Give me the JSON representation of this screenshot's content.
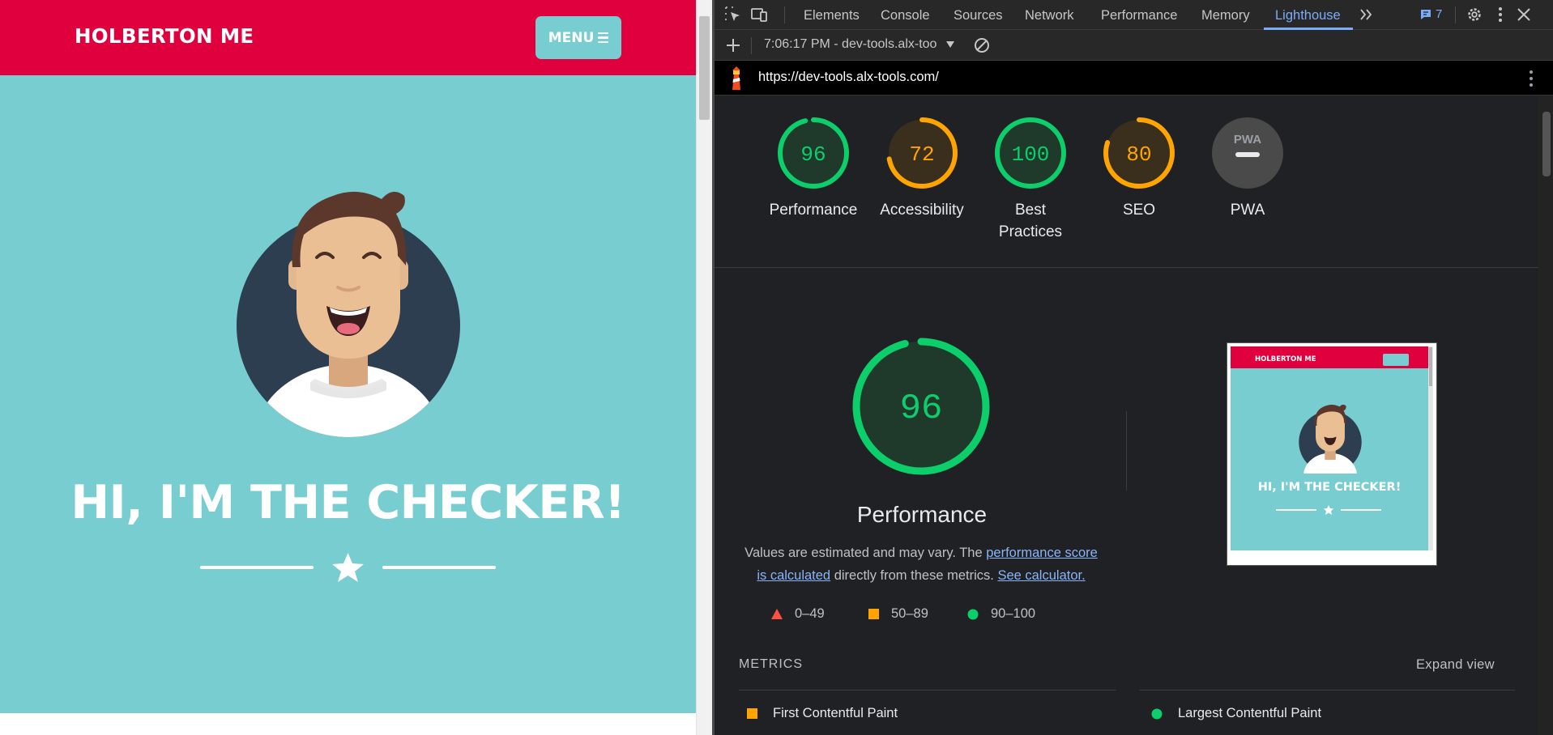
{
  "site": {
    "logo": "HOLBERTON ME",
    "menu_label": "MENU",
    "hero_title": "HI, I'M THE CHECKER!"
  },
  "devtools": {
    "tabs": [
      "Elements",
      "Console",
      "Sources",
      "Network",
      "Performance",
      "Memory",
      "Lighthouse"
    ],
    "active_tab": "Lighthouse",
    "issues_count": "7",
    "run_label": "7:06:17 PM - dev-tools.alx-too",
    "url": "https://dev-tools.alx-tools.com/"
  },
  "report": {
    "scores": [
      {
        "label": "Performance",
        "value": 96,
        "status": "pass"
      },
      {
        "label": "Accessibility",
        "value": 72,
        "status": "average"
      },
      {
        "label": "Best Practices",
        "value": 100,
        "status": "pass"
      },
      {
        "label": "SEO",
        "value": 80,
        "status": "average"
      },
      {
        "label": "PWA",
        "value": null,
        "status": "na"
      }
    ],
    "pwa_badge": "PWA",
    "main_score": 96,
    "main_title": "Performance",
    "desc_prefix": "Values are estimated and may vary. The ",
    "desc_link1": "performance score is calculated",
    "desc_middle": " directly from these metrics. ",
    "desc_link2": "See calculator.",
    "legend": [
      "0–49",
      "50–89",
      "90–100"
    ],
    "metrics_heading": "METRICS",
    "expand_label": "Expand view",
    "metrics": [
      {
        "label": "First Contentful Paint",
        "status": "average"
      },
      {
        "label": "Largest Contentful Paint",
        "status": "pass"
      }
    ],
    "thumb_logo": "HOLBERTON ME",
    "thumb_title": "HI, I'M THE CHECKER!"
  },
  "colors": {
    "site_red": "#e1003e",
    "site_teal": "#78cdd1",
    "pass": "#0cce6b",
    "average": "#ffa400",
    "fail": "#ff4e42",
    "link": "#8ab4f8",
    "active_tab": "#7cacf8"
  }
}
